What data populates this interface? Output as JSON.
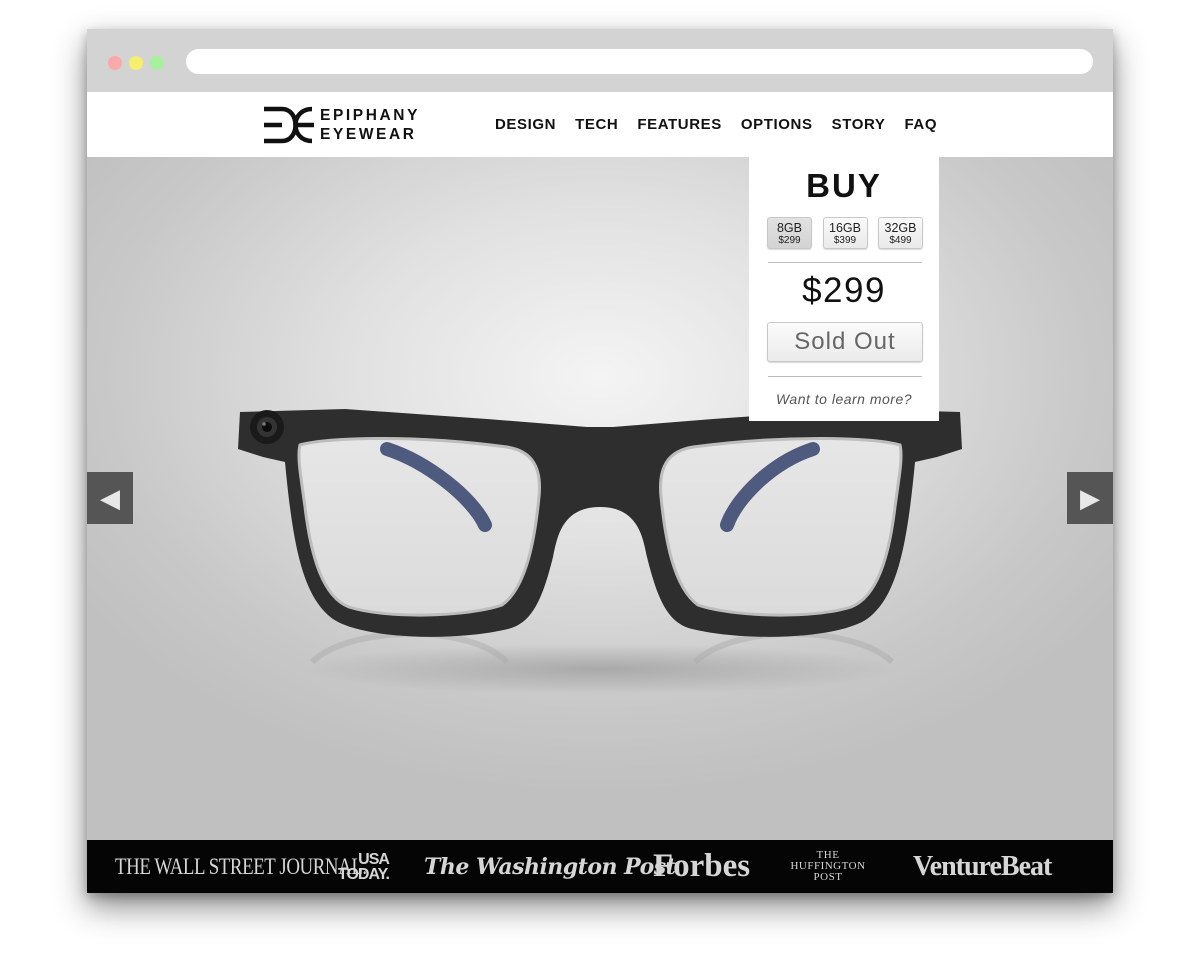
{
  "browser": {
    "url_value": ""
  },
  "brand": {
    "line1": "EPIPHANY",
    "line2": "EYEWEAR"
  },
  "nav": {
    "items": [
      "DESIGN",
      "TECH",
      "FEATURES",
      "OPTIONS",
      "STORY",
      "FAQ"
    ]
  },
  "buy_panel": {
    "title": "BUY",
    "options": [
      {
        "size": "8GB",
        "price": "$299",
        "selected": true
      },
      {
        "size": "16GB",
        "price": "$399",
        "selected": false
      },
      {
        "size": "32GB",
        "price": "$499",
        "selected": false
      }
    ],
    "price": "$299",
    "sold_out_label": "Sold Out",
    "learn_more": "Want to learn more?"
  },
  "carousel": {
    "prev_icon": "triangle-left-icon",
    "next_icon": "triangle-right-icon"
  },
  "press": {
    "wsj": "THE WALL STREET JOURNAL.",
    "usa_today_line1": "USA",
    "usa_today_line2": "TODAY.",
    "washington_post": "The Washington Post",
    "forbes": "Forbes",
    "huffington_line1": "THE",
    "huffington_line2": "HUFFINGTON",
    "huffington_line3": "POST",
    "venturebeat": "VentureBeat"
  },
  "colors": {
    "chrome": "#d3d3d3",
    "press_bar": "#050505",
    "arrow_bg": "#555555",
    "frame": "#2e2e2e",
    "temple": "#3d4a72"
  }
}
